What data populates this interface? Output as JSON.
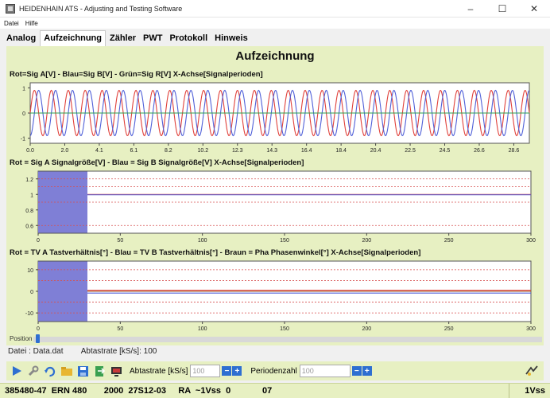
{
  "window": {
    "title": "HEIDENHAIN ATS - Adjusting and Testing Software",
    "minimize_glyph": "–",
    "maximize_glyph": "☐",
    "close_glyph": "✕"
  },
  "menu": [
    "Datei",
    "Hilfe"
  ],
  "tabs": [
    {
      "label": "Analog",
      "active": false
    },
    {
      "label": "Aufzeichnung",
      "active": true
    },
    {
      "label": "Zähler",
      "active": false
    },
    {
      "label": "PWT",
      "active": false
    },
    {
      "label": "Protokoll",
      "active": false
    },
    {
      "label": "Hinweis",
      "active": false
    }
  ],
  "page_title": "Aufzeichnung",
  "colors": {
    "panel": "#e7f0c2",
    "red": "#e0403a",
    "blue": "#5060d8",
    "green": "#2fa050",
    "shade": "#7f7fd6",
    "brown": "#a05a2a"
  },
  "chart_data": [
    {
      "type": "line",
      "title": "Rot=Sig A[V] - Blau=Sig B[V] - Grün=Sig R[V]  X-Achse[Signalperioden]",
      "xlim": [
        0,
        29.5
      ],
      "ylim": [
        -1.2,
        1.2
      ],
      "yticks": [
        1,
        0,
        -1
      ],
      "xticks": [
        "0.0",
        "2.0",
        "4.1",
        "6.1",
        "8.2",
        "10.2",
        "12.3",
        "14.3",
        "16.4",
        "18.4",
        "20.4",
        "22.5",
        "24.5",
        "26.6",
        "28.6"
      ],
      "series": [
        {
          "name": "Sig A",
          "color": "red",
          "kind": "sine",
          "amplitude": 0.9,
          "periods": 29.5,
          "phase_deg": 0
        },
        {
          "name": "Sig B",
          "color": "blue",
          "kind": "sine",
          "amplitude": 0.9,
          "periods": 29.5,
          "phase_deg": -90
        },
        {
          "name": "Sig R",
          "color": "green",
          "kind": "constant",
          "y": 0
        }
      ]
    },
    {
      "type": "line",
      "title": "Rot = Sig A Signalgröße[V] - Blau = Sig B Signalgröße[V]  X-Achse[Signalperioden]",
      "xlim": [
        0,
        300
      ],
      "ylim": [
        0.5,
        1.3
      ],
      "yticks": [
        1.2,
        1,
        0.8,
        0.6
      ],
      "xticks": [
        0,
        50,
        100,
        150,
        200,
        250,
        300
      ],
      "shaded_range": [
        0,
        30
      ],
      "limit_lines": [
        1.2,
        1.1,
        0.9,
        0.6
      ],
      "series": [
        {
          "name": "Sig A",
          "color": "red",
          "kind": "constant",
          "y": 1.0
        },
        {
          "name": "Sig B",
          "color": "blue",
          "kind": "constant",
          "y": 0.995
        }
      ]
    },
    {
      "type": "line",
      "title": "Rot = TV A Tastverhältnis[°] - Blau = TV B Tastverhältnis[°] - Braun = Pha Phasenwinkel[°]  X-Achse[Signalperioden]",
      "xlim": [
        0,
        300
      ],
      "ylim": [
        -14,
        14
      ],
      "yticks": [
        10,
        0,
        -10
      ],
      "xticks": [
        0,
        50,
        100,
        150,
        200,
        250,
        300
      ],
      "shaded_range": [
        0,
        30
      ],
      "limit_lines": [
        10,
        5,
        -5,
        -10
      ],
      "series": [
        {
          "name": "TV A",
          "color": "red",
          "kind": "constant",
          "y": 0.5
        },
        {
          "name": "TV B",
          "color": "blue",
          "kind": "constant",
          "y": -0.8
        },
        {
          "name": "Pha",
          "color": "brown",
          "kind": "constant",
          "y": 0.0
        }
      ]
    }
  ],
  "position": {
    "label": "Position",
    "value_fraction": 0.0
  },
  "file_info": {
    "file": "Datei : Data.dat",
    "rate": "Abtastrate [kS/s]: 100"
  },
  "toolbar": {
    "icons": [
      "play-icon",
      "tools-icon",
      "refresh-icon",
      "folder-icon",
      "save-icon",
      "export-icon",
      "monitor-icon"
    ],
    "rate_label": "Abtastrate [kS/s]",
    "rate_value": "100",
    "periods_label": "Periodenzahl",
    "periods_value": "100",
    "minus": "−",
    "plus": "+"
  },
  "status": {
    "text": "385480-47  ERN 480       2000  27S12-03     RA  ~1Vss  0             07",
    "right": "1Vss"
  }
}
